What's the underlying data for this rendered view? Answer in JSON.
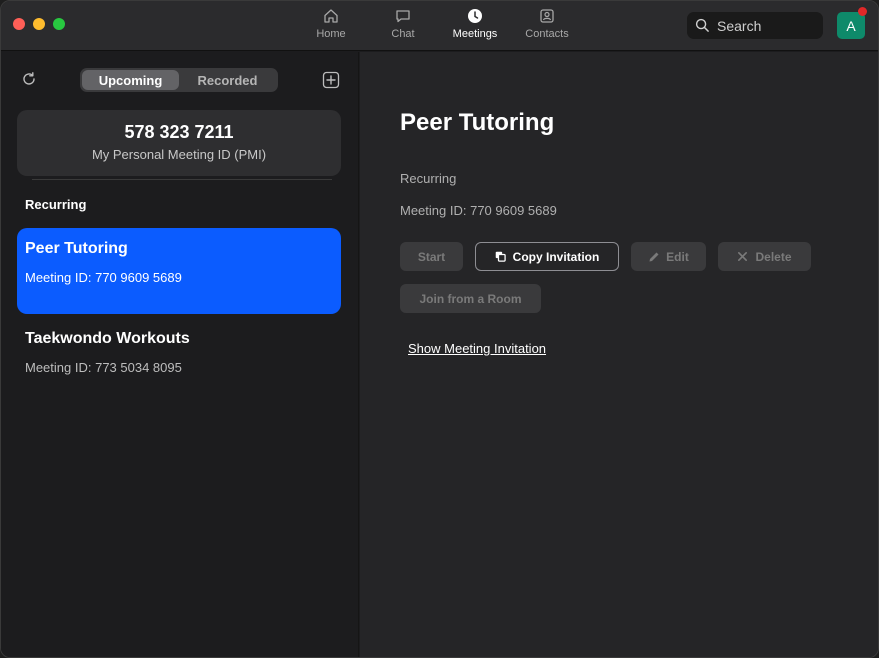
{
  "nav": {
    "tabs": [
      {
        "label": "Home",
        "icon": "home-icon",
        "active": false
      },
      {
        "label": "Chat",
        "icon": "chat-icon",
        "active": false
      },
      {
        "label": "Meetings",
        "icon": "clock-icon",
        "active": true
      },
      {
        "label": "Contacts",
        "icon": "contacts-icon",
        "active": false
      }
    ],
    "search_label": "Search",
    "avatar_initial": "A"
  },
  "sidebar": {
    "segments": [
      "Upcoming",
      "Recorded"
    ],
    "active_segment": "Upcoming",
    "pmi": {
      "number": "578 323 7211",
      "label": "My Personal Meeting ID (PMI)"
    },
    "section_label": "Recurring",
    "meetings": [
      {
        "title": "Peer Tutoring",
        "id_text": "Meeting ID: 770 9609 5689",
        "selected": true
      },
      {
        "title": "Taekwondo Workouts",
        "id_text": "Meeting ID: 773 5034 8095",
        "selected": false
      }
    ]
  },
  "detail": {
    "title": "Peer Tutoring",
    "recurrence": "Recurring",
    "meeting_id": "Meeting ID: 770 9609 5689",
    "buttons": {
      "start": "Start",
      "copy_invitation": "Copy Invitation",
      "edit": "Edit",
      "delete": "Delete",
      "join_room": "Join from a Room"
    },
    "show_invitation": "Show Meeting Invitation"
  },
  "colors": {
    "accent": "#0b5cff",
    "avatar": "#0e8a6a",
    "notification": "#e02828"
  }
}
